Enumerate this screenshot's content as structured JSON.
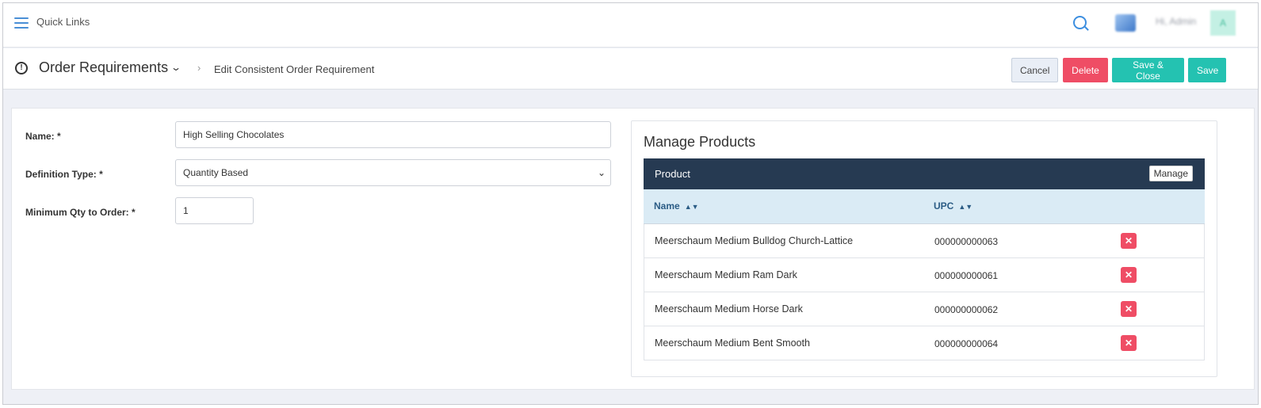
{
  "topbar": {
    "quick_links_label": "Quick Links",
    "user_name": "Hi, Admin",
    "avatar_initial": "A"
  },
  "header": {
    "page_title": "Order Requirements",
    "breadcrumb_current": "Edit Consistent Order Requirement",
    "buttons": {
      "cancel": "Cancel",
      "delete": "Delete",
      "save_close": "Save & Close",
      "save": "Save"
    }
  },
  "form": {
    "name_label": "Name: *",
    "name_value": "High Selling Chocolates",
    "definition_type_label": "Definition Type: *",
    "definition_type_value": "Quantity Based",
    "min_qty_label": "Minimum Qty to Order: *",
    "min_qty_value": "1"
  },
  "products": {
    "title": "Manage Products",
    "header_label": "Product",
    "manage_button": "Manage",
    "columns": {
      "name": "Name",
      "upc": "UPC"
    },
    "rows": [
      {
        "name": "Meerschaum Medium Bulldog Church-Lattice",
        "upc": "000000000063"
      },
      {
        "name": "Meerschaum Medium Ram Dark",
        "upc": "000000000061"
      },
      {
        "name": "Meerschaum Medium Horse Dark",
        "upc": "000000000062"
      },
      {
        "name": "Meerschaum Medium Bent Smooth",
        "upc": "000000000064"
      }
    ]
  },
  "colors": {
    "teal_button": "#24c2b1",
    "delete_red": "#ef4d65",
    "table_header_dark": "#263a52",
    "column_header_light": "#daebf5"
  }
}
